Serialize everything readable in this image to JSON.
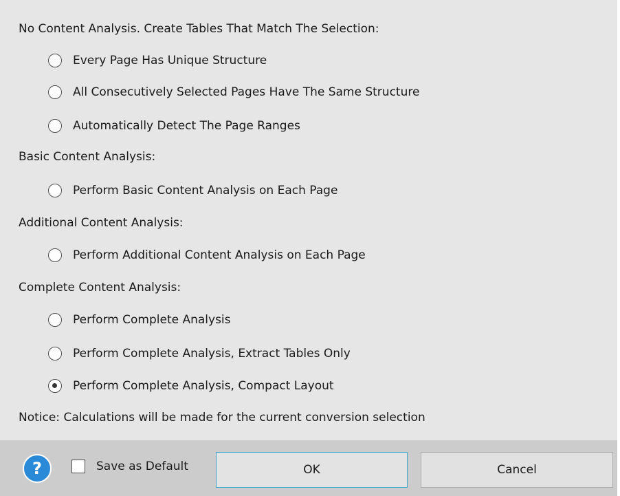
{
  "sections": {
    "no_analysis": {
      "label": "No Content Analysis. Create Tables That Match The Selection:",
      "options": [
        "Every Page Has Unique Structure",
        "All Consecutively Selected Pages Have The Same Structure",
        "Automatically Detect The Page Ranges"
      ]
    },
    "basic": {
      "label": "Basic Content Analysis:",
      "options": [
        "Perform Basic Content Analysis on Each Page"
      ]
    },
    "additional": {
      "label": "Additional Content Analysis:",
      "options": [
        "Perform Additional Content Analysis on Each Page"
      ]
    },
    "complete": {
      "label": "Complete Content Analysis:",
      "options": [
        "Perform Complete Analysis",
        "Perform Complete Analysis, Extract Tables Only",
        "Perform Complete Analysis, Compact Layout"
      ]
    }
  },
  "selected_option": "Perform Complete Analysis, Compact Layout",
  "notice": "Notice: Calculations will be made for the current conversion selection",
  "footer": {
    "help_glyph": "?",
    "save_default_label": "Save as Default",
    "save_default_checked": false,
    "ok_label": "OK",
    "cancel_label": "Cancel"
  },
  "colors": {
    "dialog_bg": "#e6e6e6",
    "footer_bg": "#cccccc",
    "help_icon": "#2b8ad8",
    "ok_focus_border": "#3fa7c7"
  },
  "icons": [
    "radio-icon",
    "radio-selected-icon",
    "help-icon",
    "checkbox-icon"
  ]
}
